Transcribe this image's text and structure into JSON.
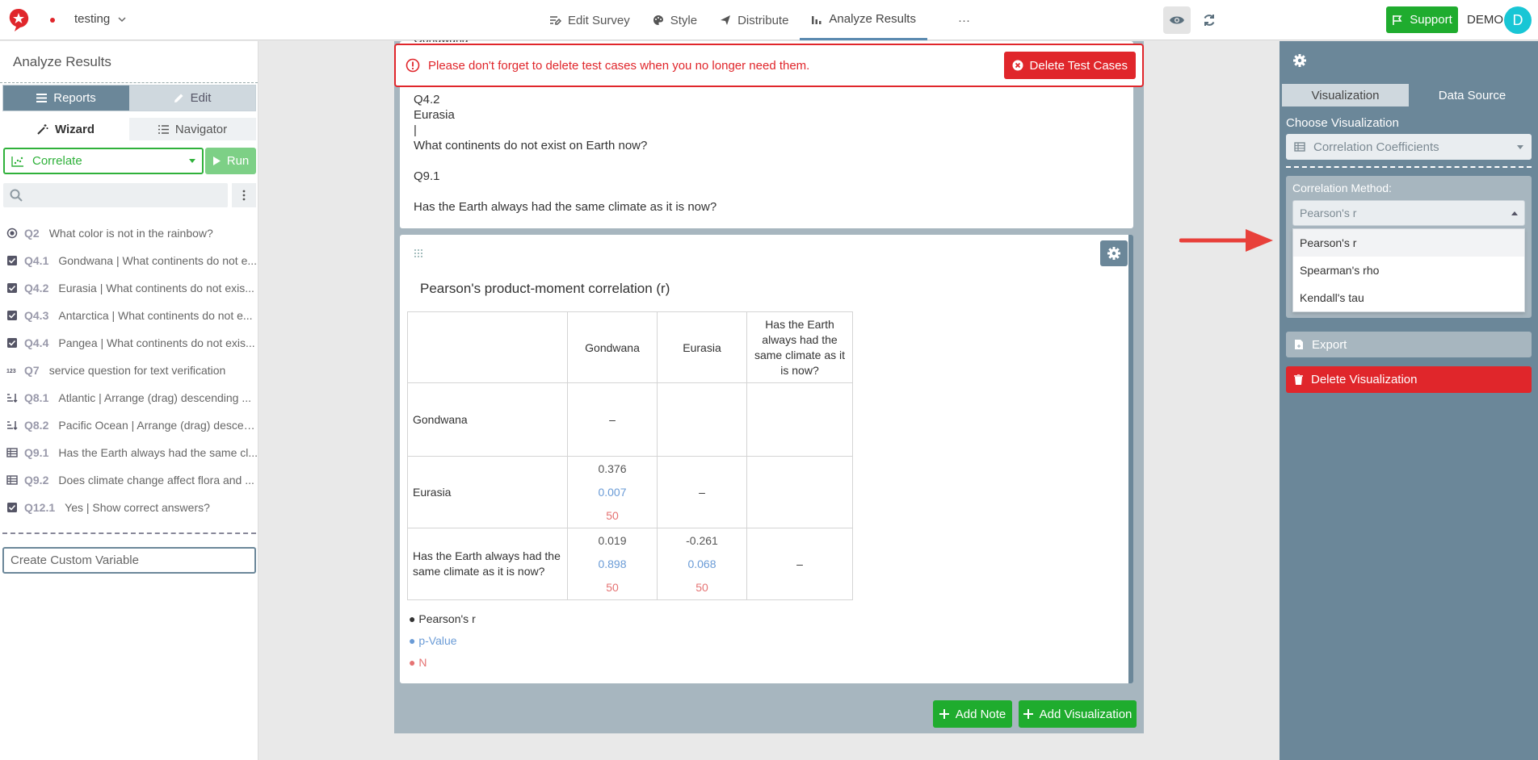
{
  "topbar": {
    "project_name": "testing",
    "nav": [
      {
        "label": "Edit Survey",
        "icon": "edit-list-icon"
      },
      {
        "label": "Style",
        "icon": "palette-icon"
      },
      {
        "label": "Distribute",
        "icon": "send-icon"
      },
      {
        "label": "Analyze Results",
        "icon": "bar-chart-icon",
        "active": true
      },
      {
        "label": "···",
        "icon": "more-icon"
      }
    ],
    "support_label": "Support",
    "user_label": "DEMO",
    "avatar_initial": "D"
  },
  "left_panel": {
    "title": "Analyze Results",
    "toggle": {
      "reports": "Reports",
      "edit": "Edit"
    },
    "tabs": {
      "wizard": "Wizard",
      "navigator": "Navigator"
    },
    "analysis_select": "Correlate",
    "run_label": "Run",
    "search_placeholder": "",
    "questions": [
      {
        "id": "Q2",
        "text": "What color is not in the rainbow?",
        "icon": "radio-icon"
      },
      {
        "id": "Q4.1",
        "text": "Gondwana | What continents do not e...",
        "icon": "checkbox-icon"
      },
      {
        "id": "Q4.2",
        "text": "Eurasia | What continents do not exis...",
        "icon": "checkbox-icon"
      },
      {
        "id": "Q4.3",
        "text": "Antarctica | What continents do not e...",
        "icon": "checkbox-icon"
      },
      {
        "id": "Q4.4",
        "text": "Pangea | What continents do not exis...",
        "icon": "checkbox-icon"
      },
      {
        "id": "Q7",
        "text": "service question for text verification",
        "icon": "numeric-icon"
      },
      {
        "id": "Q8.1",
        "text": "Atlantic | Arrange (drag) descending ...",
        "icon": "sort-icon"
      },
      {
        "id": "Q8.2",
        "text": "Pacific Ocean | Arrange (drag) descen...",
        "icon": "sort-icon"
      },
      {
        "id": "Q9.1",
        "text": "Has the Earth always had the same cl...",
        "icon": "table-icon"
      },
      {
        "id": "Q9.2",
        "text": "Does climate change affect flora and ...",
        "icon": "table-icon"
      },
      {
        "id": "Q12.1",
        "text": "Yes | Show correct answers?",
        "icon": "checkbox-icon"
      }
    ],
    "custom_variable_placeholder": "Create Custom Variable"
  },
  "center": {
    "top_cut_text": "Gondwana",
    "alert_text": "Please don't forget to delete test cases when you no longer need them.",
    "delete_test_cases_label": "Delete Test Cases",
    "card1_lines": [
      "Q4.2",
      "Eurasia",
      "|",
      "What continents do not exist on Earth now?",
      "Q9.1",
      "Has the Earth always had the same climate as it is now?"
    ],
    "report_title": "Pearson's product-moment correlation (r)",
    "table": {
      "headers": [
        "",
        "Gondwana",
        "Eurasia",
        "Has the Earth always had the same climate as it is now?"
      ],
      "rows": [
        {
          "label": "Gondwana",
          "cells": [
            {
              "dash": "–"
            },
            {},
            {}
          ]
        },
        {
          "label": "Eurasia",
          "cells": [
            {
              "r": "0.376",
              "p": "0.007",
              "n": "50"
            },
            {
              "dash": "–"
            },
            {}
          ]
        },
        {
          "label": "Has the Earth always had the same climate as it is now?",
          "cells": [
            {
              "r": "0.019",
              "p": "0.898",
              "n": "50"
            },
            {
              "r": "-0.261",
              "p": "0.068",
              "n": "50"
            },
            {
              "dash": "–"
            }
          ]
        }
      ]
    },
    "legend": [
      {
        "label": "Pearson's r",
        "color": "#333333"
      },
      {
        "label": "p-Value",
        "color": "#6a9bd6"
      },
      {
        "label": "N",
        "color": "#e57373"
      }
    ],
    "add_note_label": "Add Note",
    "add_visualization_label": "Add Visualization"
  },
  "right_panel": {
    "tabs": {
      "visualization": "Visualization",
      "data_source": "Data Source"
    },
    "choose_label": "Choose Visualization",
    "visualization_value": "Correlation Coefficients",
    "method_label": "Correlation Method:",
    "method_value": "Pearson's r",
    "method_options": [
      "Pearson's r",
      "Spearman's rho",
      "Kendall's tau"
    ],
    "export_label": "Export",
    "delete_visualization_label": "Delete Visualization"
  },
  "colors": {
    "accent_green": "#1fac2e",
    "danger_red": "#e0262b",
    "panel_slate": "#6b8799",
    "p_value_blue": "#6a9bd6",
    "n_red": "#e57373"
  }
}
